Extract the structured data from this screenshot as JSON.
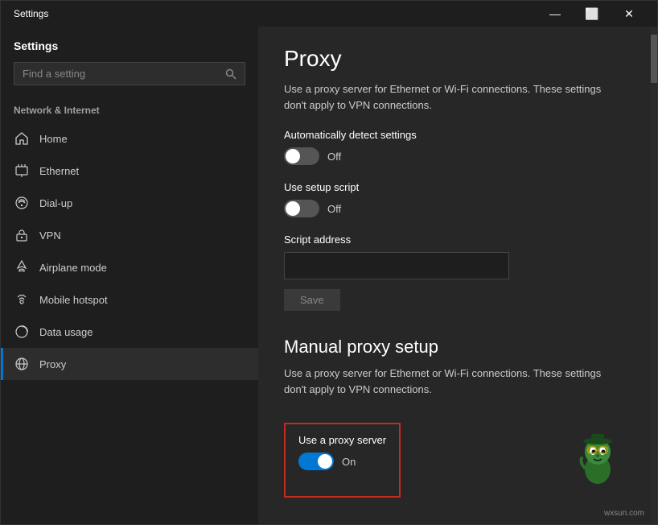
{
  "window": {
    "title": "Settings",
    "controls": {
      "minimize": "—",
      "maximize": "⬜",
      "close": "✕"
    }
  },
  "sidebar": {
    "title": "Settings",
    "search": {
      "placeholder": "Find a setting",
      "value": ""
    },
    "section_label": "Network & Internet",
    "nav_items": [
      {
        "id": "home",
        "label": "Home",
        "icon": "home"
      },
      {
        "id": "ethernet",
        "label": "Ethernet",
        "icon": "ethernet"
      },
      {
        "id": "dialup",
        "label": "Dial-up",
        "icon": "dialup"
      },
      {
        "id": "vpn",
        "label": "VPN",
        "icon": "vpn"
      },
      {
        "id": "airplane",
        "label": "Airplane mode",
        "icon": "airplane"
      },
      {
        "id": "hotspot",
        "label": "Mobile hotspot",
        "icon": "hotspot"
      },
      {
        "id": "data",
        "label": "Data usage",
        "icon": "data"
      },
      {
        "id": "proxy",
        "label": "Proxy",
        "icon": "proxy",
        "active": true
      }
    ]
  },
  "panel": {
    "title": "Proxy",
    "auto_section": {
      "desc": "Use a proxy server for Ethernet or Wi-Fi connections. These settings don't apply to VPN connections.",
      "auto_detect_label": "Automatically detect settings",
      "auto_detect_status": "Off",
      "auto_detect_on": false,
      "setup_script_label": "Use setup script",
      "setup_script_status": "Off",
      "setup_script_on": false,
      "script_address_label": "Script address",
      "script_address_placeholder": "",
      "save_label": "Save"
    },
    "manual_section": {
      "title": "Manual proxy setup",
      "desc": "Use a proxy server for Ethernet or Wi-Fi connections. These settings don't apply to VPN connections.",
      "proxy_server_label": "Use a proxy server",
      "proxy_server_status": "On",
      "proxy_server_on": true
    }
  },
  "watermark": "wxsun.com"
}
